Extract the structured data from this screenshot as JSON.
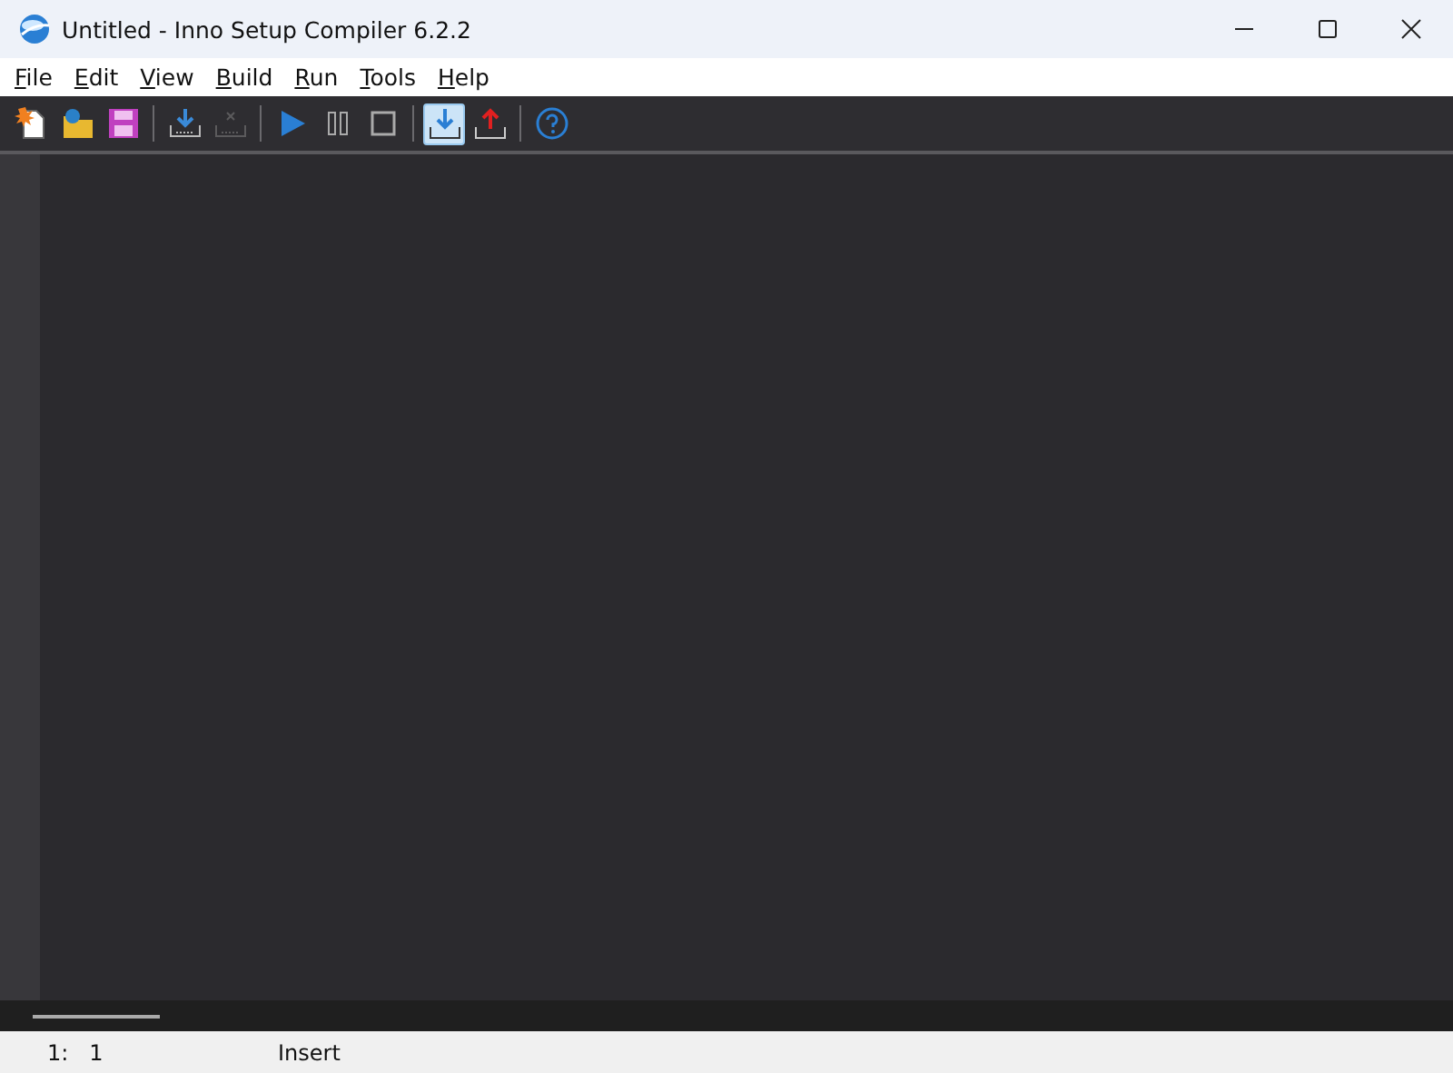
{
  "window": {
    "title": "Untitled - Inno Setup Compiler 6.2.2"
  },
  "menu": [
    "File",
    "Edit",
    "View",
    "Build",
    "Run",
    "Tools",
    "Help"
  ],
  "toolbar": [
    {
      "kind": "new",
      "pressed": false,
      "disabled": false
    },
    {
      "kind": "open",
      "pressed": false,
      "disabled": false
    },
    {
      "kind": "save",
      "pressed": false,
      "disabled": false
    },
    {
      "kind": "sep"
    },
    {
      "kind": "compile",
      "pressed": false,
      "disabled": false
    },
    {
      "kind": "stop-compile",
      "pressed": false,
      "disabled": true
    },
    {
      "kind": "sep"
    },
    {
      "kind": "run",
      "pressed": false,
      "disabled": false
    },
    {
      "kind": "pause",
      "pressed": false,
      "disabled": false
    },
    {
      "kind": "stop",
      "pressed": false,
      "disabled": false
    },
    {
      "kind": "sep"
    },
    {
      "kind": "target-install",
      "pressed": true,
      "disabled": false
    },
    {
      "kind": "target-uninstall",
      "pressed": false,
      "disabled": false
    },
    {
      "kind": "sep"
    },
    {
      "kind": "help",
      "pressed": false,
      "disabled": false
    }
  ],
  "status_bar": {
    "position": "1:   1",
    "mode": "Insert"
  }
}
